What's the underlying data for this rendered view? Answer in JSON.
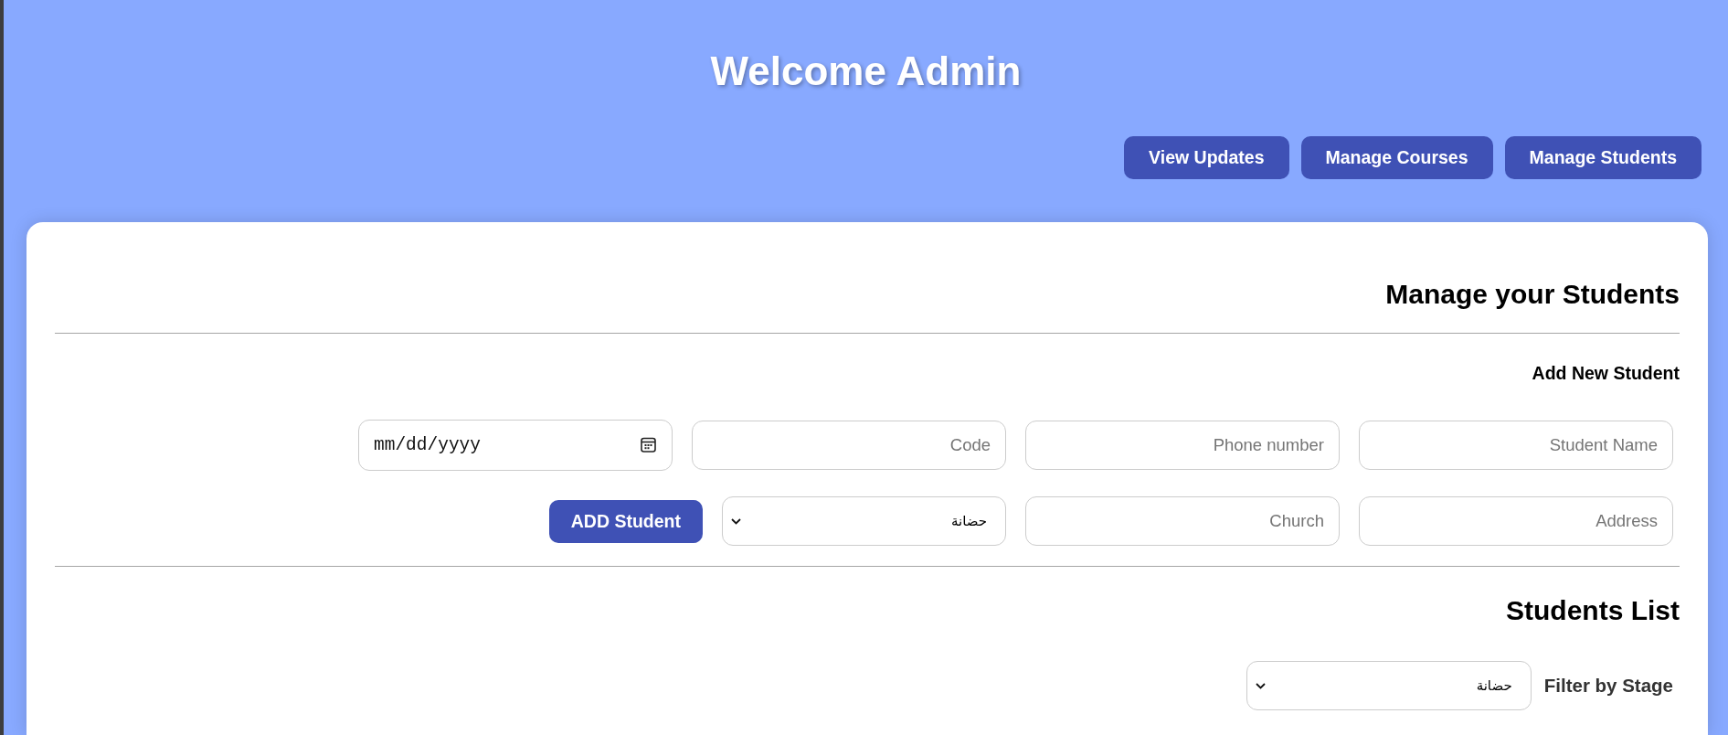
{
  "header": {
    "title": "Welcome Admin",
    "nav_buttons": [
      {
        "label": "View Updates"
      },
      {
        "label": "Manage Courses"
      },
      {
        "label": "Manage Students"
      }
    ]
  },
  "card": {
    "title": "Manage your Students",
    "add_form": {
      "title": "Add New Student",
      "field_rows": [
        [
          {
            "kind": "date",
            "placeholder": "mm/dd/yyyy"
          },
          {
            "kind": "text",
            "placeholder": "Code"
          },
          {
            "kind": "text",
            "placeholder": "Phone number"
          },
          {
            "kind": "text",
            "placeholder": "Student Name"
          }
        ],
        [
          {
            "kind": "button",
            "label": "ADD Student"
          },
          {
            "kind": "select",
            "value": "حضانة"
          },
          {
            "kind": "text",
            "placeholder": "Church"
          },
          {
            "kind": "text",
            "placeholder": "Address"
          }
        ]
      ]
    },
    "students_list": {
      "title": "Students List",
      "filter": {
        "label": "Filter by Stage",
        "value": "حضانة"
      }
    }
  }
}
